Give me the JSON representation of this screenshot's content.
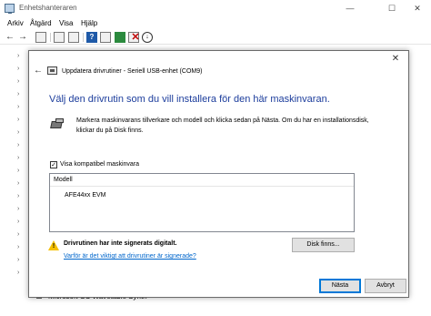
{
  "app": {
    "title": "Enhetshanteraren",
    "window_controls": {
      "minimize": "—",
      "maximize": "☐",
      "close": "✕"
    },
    "menu": [
      "Arkiv",
      "Åtgärd",
      "Visa",
      "Hjälp"
    ],
    "tree_last_item": "Microsoft GS Wavetable Synth"
  },
  "dialog": {
    "title": "Uppdatera drivrutiner - Seriell USB-enhet (COM9)",
    "close_glyph": "✕",
    "back_glyph": "←",
    "heading": "Välj den drivrutin som du vill installera för den här maskinvaran.",
    "instructions": "Markera maskinvarans tillverkare och modell och klicka sedan på Nästa. Om du har en installationsdisk, klickar du på Disk finns.",
    "checkbox": {
      "label": "Visa kompatibel maskinvara",
      "checked": true,
      "glyph": "✓"
    },
    "model_list": {
      "header": "Modell",
      "items": [
        "AFE44xx EVM"
      ]
    },
    "disk_button": "Disk finns...",
    "warning": "Drivrutinen har inte signerats digitalt.",
    "warning_mark": "!",
    "link": "Varför är det viktigt att drivrutiner är signerade?",
    "next_button": "Nästa",
    "cancel_button": "Avbryt"
  },
  "colors": {
    "heading": "#1c3d9c",
    "link": "#0066cc",
    "primary_border": "#0078d7",
    "warning": "#f5c000"
  },
  "icons": {
    "back": "back-arrow-icon",
    "forward": "forward-arrow-icon",
    "device": "device-icon",
    "hardware": "hardware-icon",
    "warning": "warning-icon"
  }
}
